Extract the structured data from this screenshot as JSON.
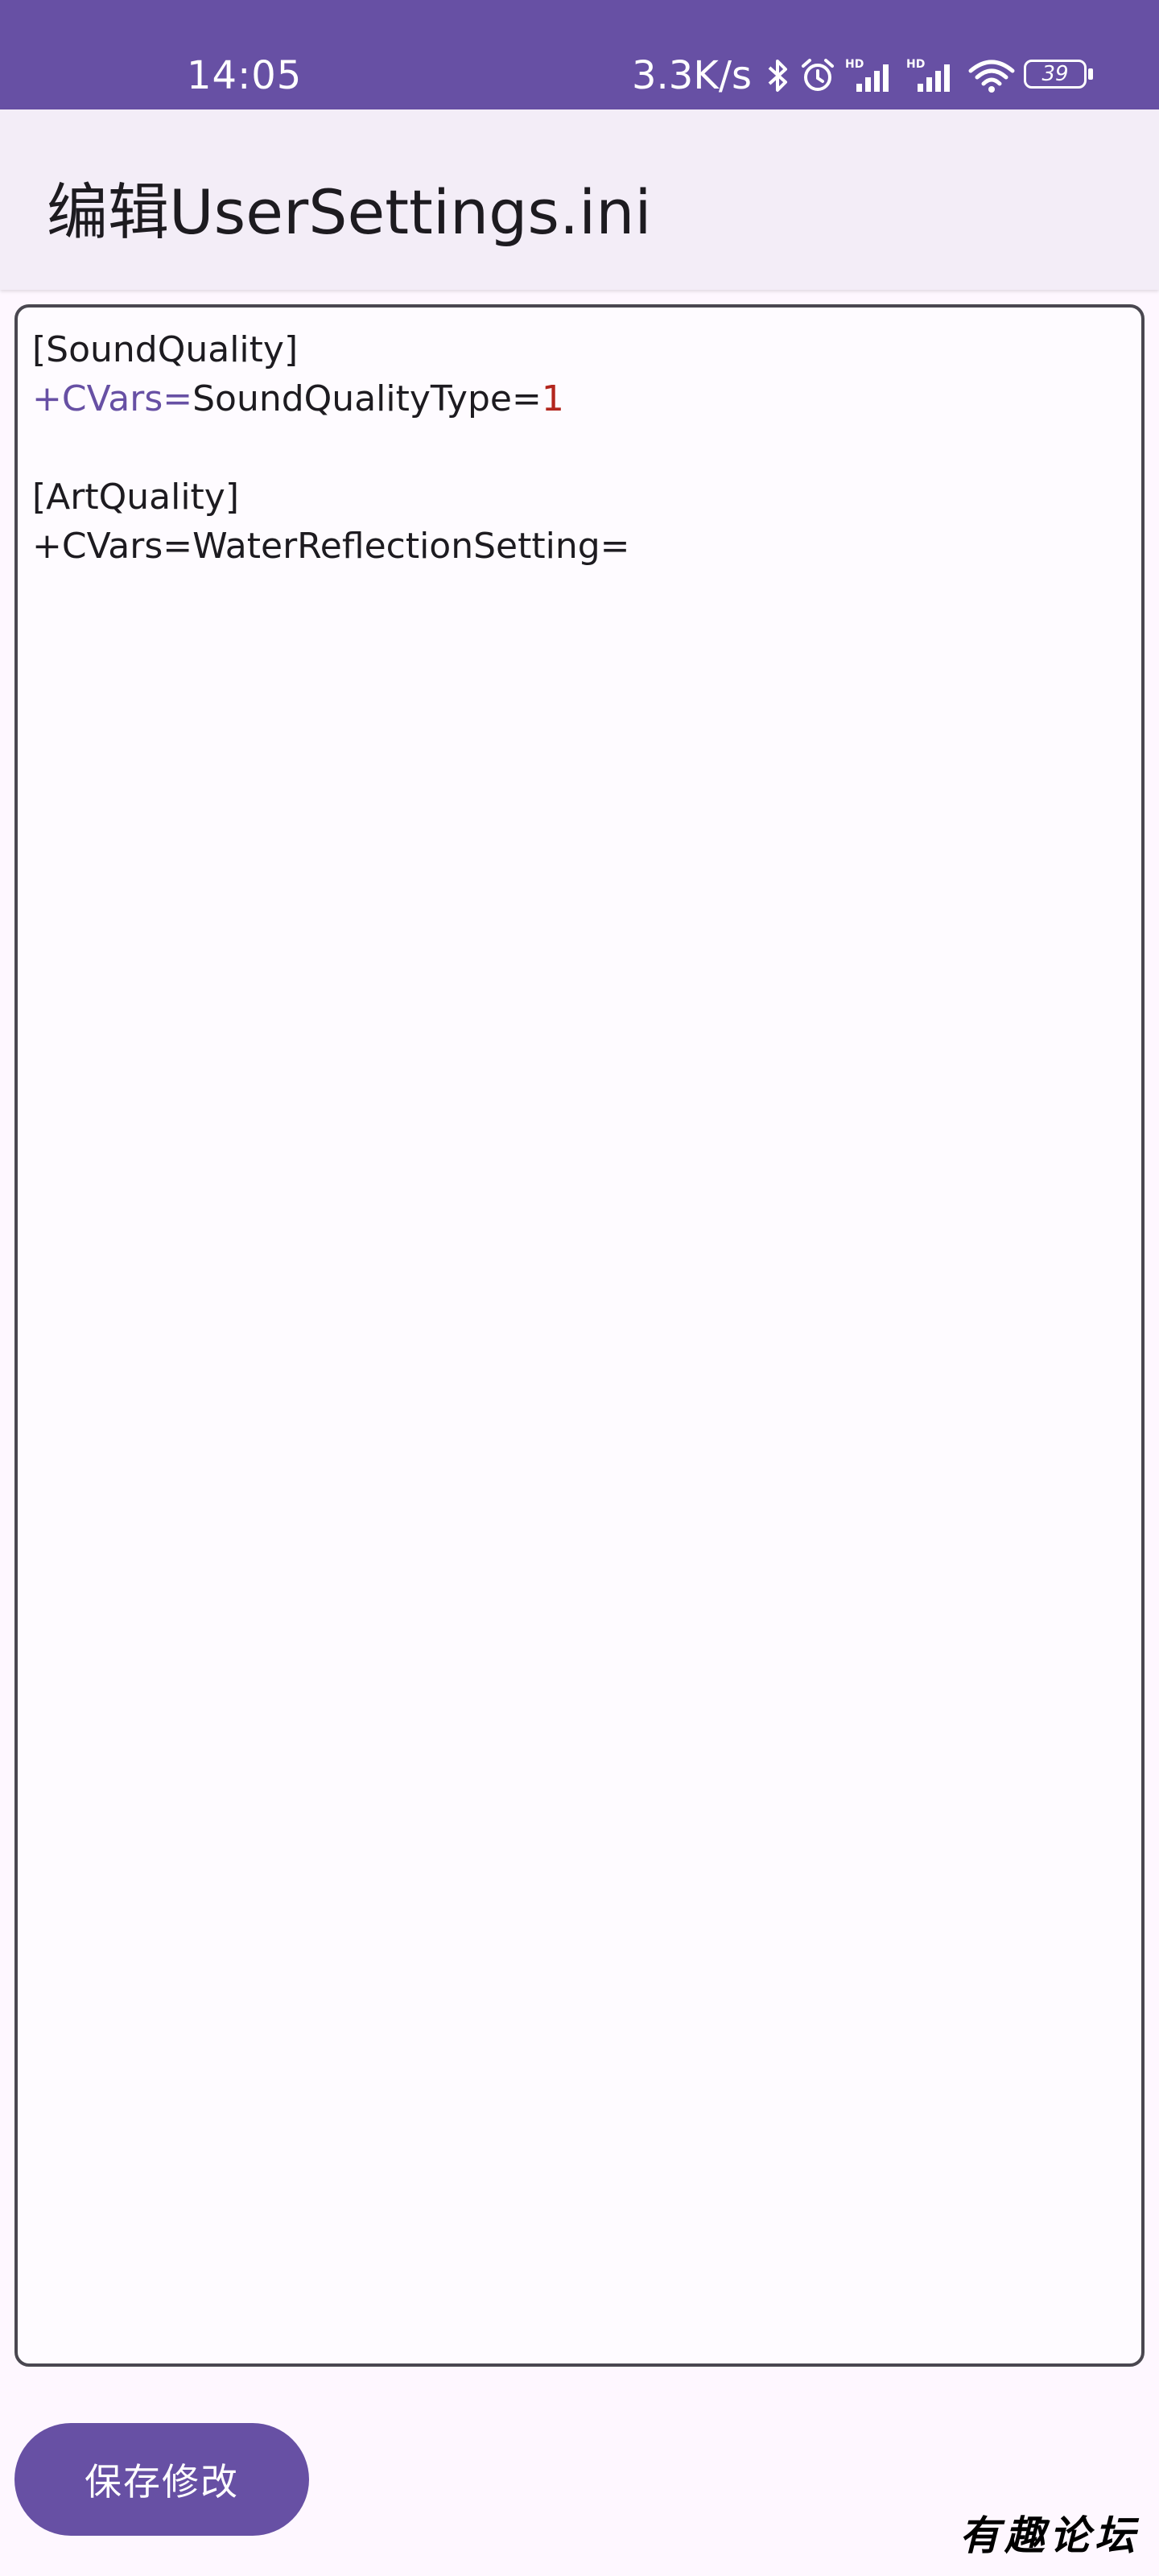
{
  "status_bar": {
    "time": "14:05",
    "speed": "3.3K/s",
    "battery": "39",
    "icons": [
      "bluetooth-icon",
      "alarm-icon",
      "hd-signal-icon",
      "hd-signal-icon",
      "wifi-icon",
      "battery-icon"
    ]
  },
  "app_bar": {
    "title": "编辑UserSettings.ini"
  },
  "editor": {
    "lines": [
      {
        "plain": "[SoundQuality]"
      },
      {
        "key": "+CVars=",
        "rest": "SoundQualityType=",
        "value": "1"
      },
      {
        "plain": ""
      },
      {
        "plain": "[ArtQuality]"
      },
      {
        "plain": "+CVars=WaterReflectionSetting="
      }
    ],
    "colors": {
      "key": "#6750A4",
      "value": "#B3261E",
      "text": "#1d1b20"
    }
  },
  "actions": {
    "save_label": "保存修改"
  },
  "watermark": {
    "text": "有趣论坛"
  },
  "colors": {
    "primary": "#6750A4",
    "app_bar_bg": "#F3EDF7",
    "page_bg": "#FEF7FF"
  }
}
